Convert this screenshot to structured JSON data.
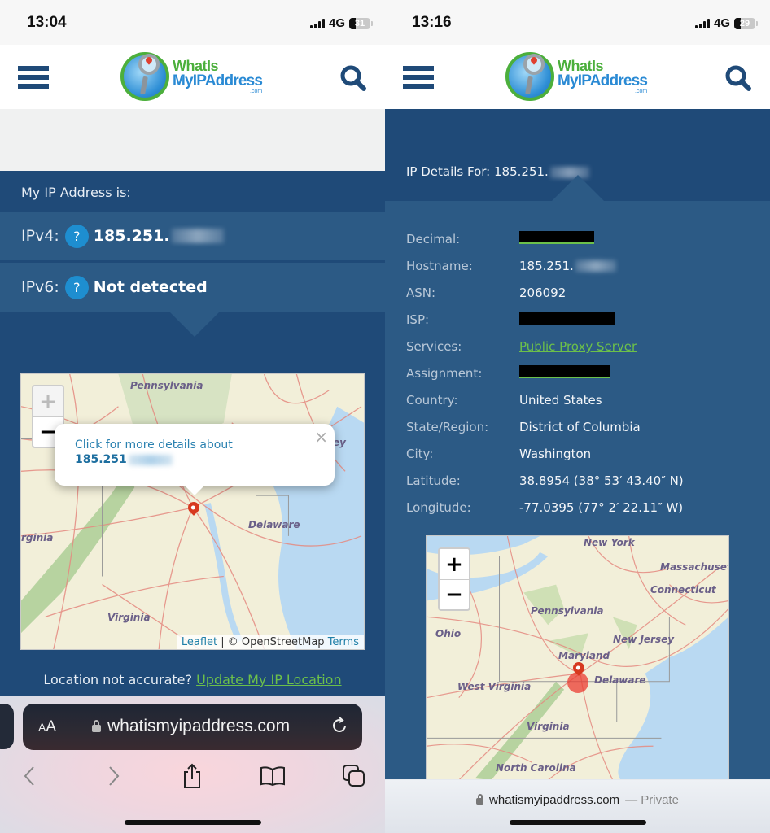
{
  "left": {
    "status": {
      "time": "13:04",
      "network": "4G",
      "battery": "31",
      "battery_level": 0.31
    },
    "site": {
      "logo_line1": "WhatIs",
      "logo_line2": "MyIPAddress",
      "logo_line3": ".com"
    },
    "ip_panel": {
      "title": "My IP Address is:",
      "ipv4_label": "IPv4:",
      "ipv4_value": "185.251.",
      "ipv6_label": "IPv6:",
      "ipv6_value": "Not detected",
      "help_glyph": "?"
    },
    "map": {
      "zoom_in": "+",
      "zoom_out": "−",
      "states": [
        "Pennsylvania",
        "rginia",
        "Delaware",
        "Virginia",
        "ey"
      ],
      "popup_line1": "Click for more details about",
      "popup_ip": "185.251",
      "popup_close": "×",
      "attribution_leaflet": "Leaflet",
      "attribution_sep": " | © OpenStreetMap ",
      "attribution_terms": "Terms"
    },
    "location_note": {
      "text": "Location not accurate? ",
      "link": "Update My IP Location"
    },
    "safari": {
      "aa_small": "A",
      "aa_large": "A",
      "url": "whatismyipaddress.com"
    }
  },
  "right": {
    "status": {
      "time": "13:16",
      "network": "4G",
      "battery": "29",
      "battery_level": 0.29
    },
    "site": {
      "logo_line1": "WhatIs",
      "logo_line2": "MyIPAddress",
      "logo_line3": ".com"
    },
    "details_title": "IP Details For: 185.251.",
    "details": [
      {
        "key": "Decimal:",
        "value": "",
        "redacted": true
      },
      {
        "key": "Hostname:",
        "value": "185.251."
      },
      {
        "key": "ASN:",
        "value": "206092"
      },
      {
        "key": "ISP:",
        "value": "",
        "redacted": true
      },
      {
        "key": "Services:",
        "value": "Public Proxy Server",
        "link": true
      },
      {
        "key": "Assignment:",
        "value": "",
        "redacted": true
      },
      {
        "key": "Country:",
        "value": "United States"
      },
      {
        "key": "State/Region:",
        "value": "District of Columbia"
      },
      {
        "key": "City:",
        "value": "Washington"
      },
      {
        "key": "Latitude:",
        "value": "38.8954 (38° 53′ 43.40″ N)"
      },
      {
        "key": "Longitude:",
        "value": "-77.0395 (77° 2′ 22.11″ W)"
      }
    ],
    "map": {
      "zoom_in": "+",
      "zoom_out": "−",
      "states": [
        "New York",
        "Massachusetts",
        "Connecticut",
        "Pennsylvania",
        "Ohio",
        "New Jersey",
        "Maryland",
        "Delaware",
        "West Virginia",
        "Virginia",
        "North Carolina"
      ]
    },
    "safari": {
      "url": "whatismyipaddress.com",
      "private_label": "— Private"
    }
  },
  "colors": {
    "navy": "#1f4a78",
    "panel": "#2c5a85",
    "help": "#1e8ed0",
    "link_green": "#6cc04a",
    "brand_green": "#4caf3c",
    "brand_blue": "#2a8ad4"
  }
}
